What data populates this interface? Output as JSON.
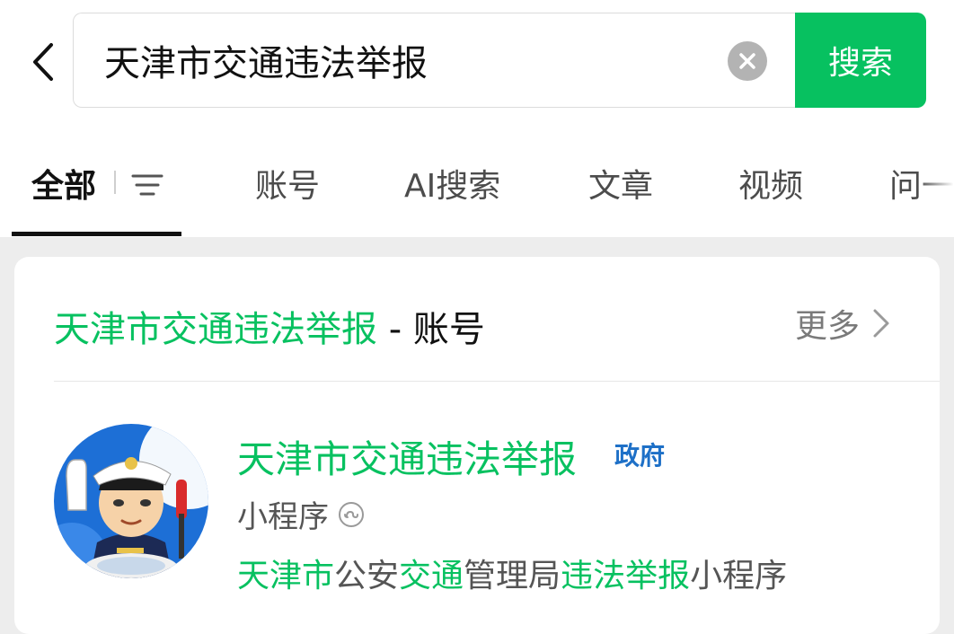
{
  "search": {
    "query": "天津市交通违法举报",
    "button_label": "搜索"
  },
  "tabs": [
    {
      "label": "全部",
      "active": true
    },
    {
      "label": "账号"
    },
    {
      "label": "AI搜索"
    },
    {
      "label": "文章"
    },
    {
      "label": "视频"
    },
    {
      "label": "问一"
    }
  ],
  "section": {
    "title_highlight": "天津市交通违法举报",
    "title_suffix": " - 账号",
    "more_label": "更多"
  },
  "result": {
    "name": "天津市交通违法举报",
    "badge": "政府",
    "type": "小程序",
    "desc_parts": [
      {
        "text": "天津市",
        "hl": true
      },
      {
        "text": "公安",
        "hl": false
      },
      {
        "text": "交通",
        "hl": true
      },
      {
        "text": "管理局",
        "hl": false
      },
      {
        "text": "违法举报",
        "hl": true
      },
      {
        "text": "小程序",
        "hl": false
      }
    ]
  },
  "colors": {
    "accent": "#07c160",
    "badge": "#1e70c7",
    "background": "#ededed"
  },
  "icons": {
    "back": "chevron-left-icon",
    "clear": "clear-icon",
    "filter": "filter-icon",
    "more": "chevron-right-icon",
    "miniprogram": "miniprogram-icon"
  }
}
